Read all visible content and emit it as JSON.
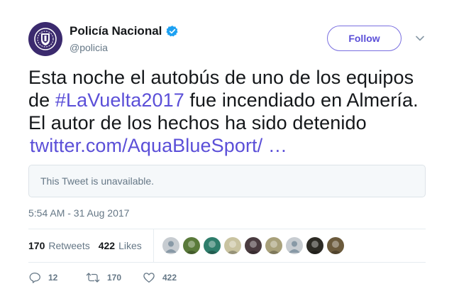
{
  "author": {
    "display_name": "Policía Nacional",
    "handle": "@policia",
    "verified": true,
    "avatar_icon": "police-shield-logo",
    "avatar_color": "#3b2a6e"
  },
  "follow_label": "Follow",
  "tweet": {
    "line1": "Esta noche el autobús de uno de los equipos",
    "line2_prefix": "de ",
    "hashtag": "#LaVuelta2017",
    "line2_suffix": " fue incendiado en Almería.",
    "line3": "El autor de los hechos ha sido detenido",
    "link": "twitter.com/AquaBlueSport/ …"
  },
  "quoted_unavailable": "This Tweet is unavailable.",
  "timestamp": "5:54 AM - 31 Aug 2017",
  "stats": {
    "retweets_count": "170",
    "retweets_label": "Retweets",
    "likes_count": "422",
    "likes_label": "Likes"
  },
  "liker_avatars": [
    {
      "name": "liker-avatar-1",
      "color": "#c7ccd1"
    },
    {
      "name": "liker-avatar-2",
      "color": "#5a7a3a"
    },
    {
      "name": "liker-avatar-3",
      "color": "#2e7d6b"
    },
    {
      "name": "liker-avatar-4",
      "color": "#c9c3a0"
    },
    {
      "name": "liker-avatar-5",
      "color": "#4a3b3f"
    },
    {
      "name": "liker-avatar-6",
      "color": "#a8a07a"
    },
    {
      "name": "liker-avatar-7",
      "color": "#c7ccd1"
    },
    {
      "name": "liker-avatar-8",
      "color": "#2c2a24"
    },
    {
      "name": "liker-avatar-9",
      "color": "#6b5a3c"
    }
  ],
  "actions": {
    "reply_count": "12",
    "retweet_count": "170",
    "like_count": "422"
  },
  "colors": {
    "accent": "#5b4fd8",
    "verified_badge": "#1da1f2",
    "muted_text": "#657786"
  }
}
